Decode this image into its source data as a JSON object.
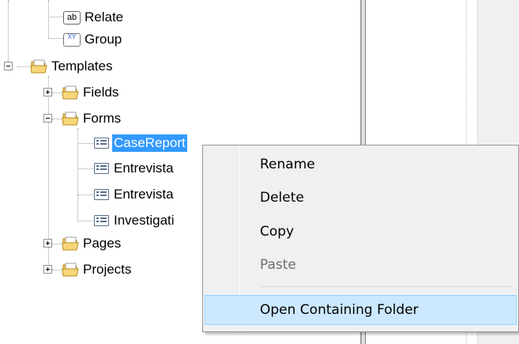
{
  "tree": {
    "nodes": [
      {
        "id": "relate",
        "label": "Relate",
        "icon": "ab-field-icon",
        "text": "ab"
      },
      {
        "id": "group",
        "label": "Group",
        "icon": "xy-group-icon",
        "text": "XY"
      },
      {
        "id": "templates",
        "label": "Templates",
        "icon": "folder-icon",
        "expanded": true
      },
      {
        "id": "fields",
        "label": "Fields",
        "icon": "folder-icon",
        "expanded": false
      },
      {
        "id": "forms",
        "label": "Forms",
        "icon": "folder-icon",
        "expanded": true
      },
      {
        "id": "casereport",
        "label": "CaseReport",
        "icon": "form-icon",
        "selected": true
      },
      {
        "id": "entrevista1",
        "label": "Entrevista",
        "icon": "form-icon"
      },
      {
        "id": "entrevista2",
        "label": "Entrevista",
        "icon": "form-icon"
      },
      {
        "id": "investigation",
        "label": "Investigati",
        "icon": "form-icon"
      },
      {
        "id": "pages",
        "label": "Pages",
        "icon": "folder-icon",
        "expanded": false
      },
      {
        "id": "projects",
        "label": "Projects",
        "icon": "folder-icon",
        "expanded": false
      }
    ]
  },
  "context_menu": {
    "items": [
      {
        "label": "Rename",
        "enabled": true
      },
      {
        "label": "Delete",
        "enabled": true
      },
      {
        "label": "Copy",
        "enabled": true
      },
      {
        "label": "Paste",
        "enabled": false
      },
      {
        "label": "Open Containing Folder",
        "enabled": true,
        "highlighted": true
      }
    ]
  },
  "colors": {
    "selection": "#3399ff",
    "menu_background": "#f0f0f0",
    "menu_highlight": "#cce8ff",
    "disabled_text": "#6d6d6d",
    "folder": "#f2c65a"
  }
}
